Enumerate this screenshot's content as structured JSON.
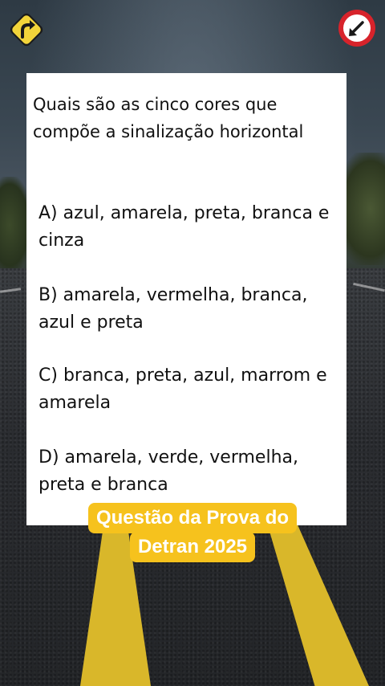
{
  "question": {
    "text": "Quais são as cinco cores que compõe a sinalização horizontal"
  },
  "options": [
    {
      "letter": "A",
      "text": "A) azul, amarela, preta, branca e cinza"
    },
    {
      "letter": "B",
      "text": "B) amarela, vermelha, branca, azul e preta"
    },
    {
      "letter": "C",
      "text": "C) branca, preta, azul, marrom e amarela"
    },
    {
      "letter": "D",
      "text": "D) amarela, verde, vermelha, preta e branca"
    }
  ],
  "caption": {
    "line1": "Questão da Prova do",
    "line2": "Detran 2025"
  },
  "icons": {
    "left": "road-curve-sign-icon",
    "right": "direction-arrow-sign-icon"
  },
  "colors": {
    "caption_bg": "#f6c21d",
    "caption_text": "#ffffff",
    "card_bg": "#ffffff",
    "sign_yellow": "#f2d43a",
    "sign_red": "#d7232b"
  }
}
